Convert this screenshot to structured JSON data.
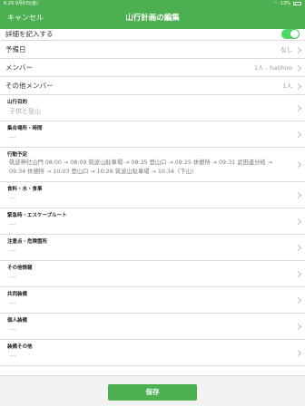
{
  "status_bar": {
    "time": "6:29",
    "date": "9月6日(金)",
    "battery": "13%"
  },
  "nav": {
    "cancel_label": "キャンセル",
    "title": "山行計画の編集"
  },
  "rows": {
    "details_toggle": {
      "label": "詳細を記入する",
      "on": true
    },
    "reserve_day": {
      "label": "予備日",
      "value": "なし"
    },
    "members": {
      "label": "メンバー",
      "value": "1人 - hatihiro"
    },
    "other_members": {
      "label": "その他メンバー",
      "value": "1人"
    }
  },
  "details": [
    {
      "label": "山行目的",
      "value": "子供と登山"
    },
    {
      "label": "集合場所・時間",
      "value": "---"
    },
    {
      "label": "行動予定",
      "value": "筑波神社山門 08:00 → 08:09 筑波山駐車場 → 08:35 登山口 → 09:25 休憩所 → 09:31 武田遺分岐 → 09:34 休憩所 → 10:03 登山口 → 10:26 筑波山駐車場 → 10:34（下山）"
    },
    {
      "label": "食料・水・食事",
      "value": "---"
    },
    {
      "label": "緊急時・エスケープルート",
      "value": "---"
    },
    {
      "label": "注意点・危険箇所",
      "value": "---"
    },
    {
      "label": "その他情報",
      "value": "---"
    },
    {
      "label": "共同装備",
      "value": "---"
    },
    {
      "label": "個人装備",
      "value": "---"
    },
    {
      "label": "装備その他",
      "value": "---"
    }
  ],
  "footer": {
    "save_label": "保存"
  },
  "colors": {
    "brand_green": "#4caf50",
    "toggle_green": "#4cd964"
  }
}
